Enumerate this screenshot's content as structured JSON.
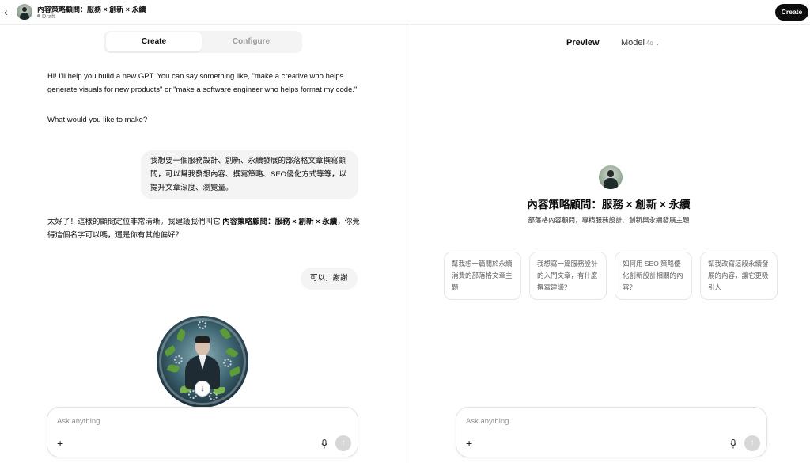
{
  "topbar": {
    "back_icon": "chevron-left-icon",
    "title": "內容策略顧問：服務 × 創新 × 永續",
    "status": "Draft",
    "create_label": "Create"
  },
  "builder": {
    "tabs": [
      {
        "label": "Create",
        "active": true
      },
      {
        "label": "Configure",
        "active": false
      }
    ],
    "messages": {
      "assistant_intro": "Hi! I'll help you build a new GPT. You can say something like, \"make a creative who helps generate visuals for new products\" or \"make a software engineer who helps format my code.\"",
      "assistant_question": "What would you like to make?",
      "user_request": "我想要一個服務設計、創新、永續發展的部落格文章撰寫顧問，可以幫我發想內容、撰寫策略、SEO優化方式等等，以提升文章深度、瀏覽量。",
      "assistant_reply_prefix": "太好了！這樣的顧問定位非常清晰。我建議我們叫它 ",
      "assistant_reply_name": "內容策略顧問：服務 × 創新 × 永續",
      "assistant_reply_suffix": "，你覺得這個名字可以嗎，還是你有其他偏好？",
      "user_confirm": "可以，謝謝"
    },
    "composer": {
      "placeholder": "Ask anything"
    }
  },
  "preview": {
    "label": "Preview",
    "model_label": "Model",
    "model_version": "4o",
    "gpt_name": "內容策略顧問：服務 × 創新 × 永續",
    "gpt_description": "部落格內容顧問，專精服務設計、創新與永續發展主題",
    "conversation_starters": [
      "幫我想一篇關於永續消費的部落格文章主題",
      "我想寫一篇服務設計的入門文章，有什麼撰寫建議？",
      "如何用 SEO 策略優化創新設計相關的內容？",
      "幫我改寫這段永續發展的內容，讓它更吸引人"
    ],
    "composer": {
      "placeholder": "Ask anything"
    }
  },
  "colors": {
    "accent": "#0d0d0d",
    "bubble": "#f4f4f4",
    "border": "#e5e5e5"
  }
}
